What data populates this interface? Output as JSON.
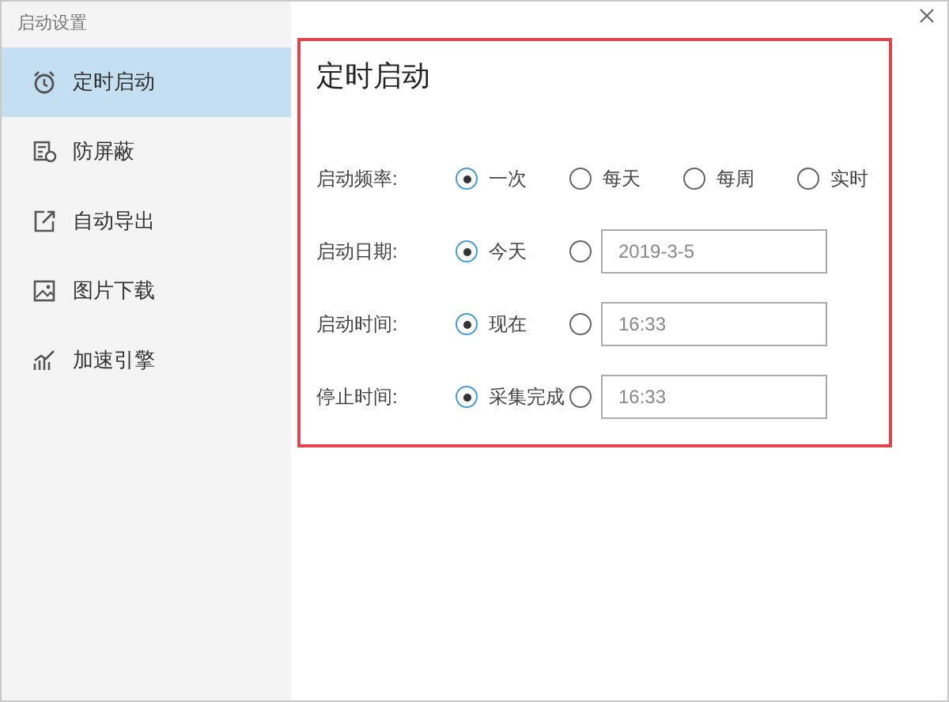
{
  "window": {
    "title": "启动设置"
  },
  "sidebar": {
    "items": [
      {
        "label": "定时启动",
        "selected": true
      },
      {
        "label": "防屏蔽",
        "selected": false
      },
      {
        "label": "自动导出",
        "selected": false
      },
      {
        "label": "图片下载",
        "selected": false
      },
      {
        "label": "加速引擎",
        "selected": false
      }
    ]
  },
  "panel": {
    "title": "定时启动",
    "rows": [
      {
        "label": "启动频率:",
        "options": [
          {
            "kind": "text",
            "label": "一次",
            "selected": true
          },
          {
            "kind": "text",
            "label": "每天",
            "selected": false
          },
          {
            "kind": "text",
            "label": "每周",
            "selected": false
          },
          {
            "kind": "text",
            "label": "实时",
            "selected": false
          }
        ]
      },
      {
        "label": "启动日期:",
        "options": [
          {
            "kind": "text",
            "label": "今天",
            "selected": true
          },
          {
            "kind": "field",
            "value": "2019-3-5",
            "selected": false
          }
        ]
      },
      {
        "label": "启动时间:",
        "options": [
          {
            "kind": "text",
            "label": "现在",
            "selected": true
          },
          {
            "kind": "field",
            "value": "16:33",
            "selected": false
          }
        ]
      },
      {
        "label": "停止时间:",
        "options": [
          {
            "kind": "text",
            "label": "采集完成",
            "selected": true
          },
          {
            "kind": "field",
            "value": "16:33",
            "selected": false
          }
        ]
      }
    ]
  }
}
